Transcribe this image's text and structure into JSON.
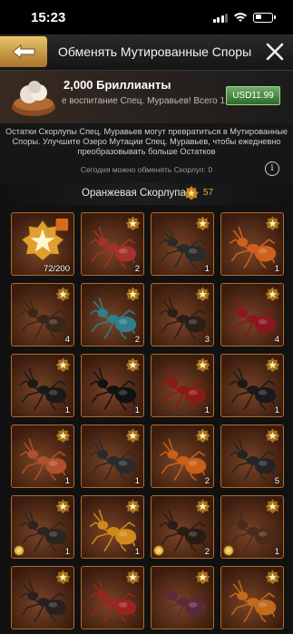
{
  "status": {
    "time": "15:23"
  },
  "header": {
    "title": "Обменять Мутированные Споры"
  },
  "offer": {
    "title": "2,000 Бриллианты",
    "subtitle": "е воспитание Спец. Муравьев! Всего 15",
    "price": "USD11.99"
  },
  "info": {
    "text": "Остатки Скорлупы Спец. Муравьев могут превратиться в Мутированные Споры. Улучшите Озеро Мутации Спец. Муравьев, чтобы ежедневно преобразовывать больше Остатков",
    "daily": "Сегодня можно обменять Скорлуп: 0"
  },
  "section": {
    "label": "Оранжевая Скорлупа",
    "count": "57"
  },
  "colors": {
    "accent": "#e0b040",
    "tile_border": "#b06a2a",
    "price_green": "#3f8a38"
  },
  "items": [
    {
      "kind": "medal",
      "qty": "72/200",
      "color": "#e0a030"
    },
    {
      "kind": "ant",
      "qty": "2",
      "color": "#a3322a"
    },
    {
      "kind": "ant",
      "qty": "1",
      "color": "#2a2a2a"
    },
    {
      "kind": "ant",
      "qty": "1",
      "color": "#d0601e"
    },
    {
      "kind": "ant",
      "qty": "4",
      "color": "#3a2618"
    },
    {
      "kind": "ant",
      "qty": "2",
      "color": "#2f7f8a"
    },
    {
      "kind": "ant",
      "qty": "3",
      "color": "#2a1e18"
    },
    {
      "kind": "ant",
      "qty": "4",
      "color": "#8a1620"
    },
    {
      "kind": "ant",
      "qty": "1",
      "color": "#1a1a1a"
    },
    {
      "kind": "ant",
      "qty": "1",
      "color": "#121212"
    },
    {
      "kind": "ant",
      "qty": "1",
      "color": "#8a1a14"
    },
    {
      "kind": "ant",
      "qty": "1",
      "color": "#1a1a1a"
    },
    {
      "kind": "ant",
      "qty": "1",
      "color": "#b0502a"
    },
    {
      "kind": "ant",
      "qty": "1",
      "color": "#2a2a2a"
    },
    {
      "kind": "ant",
      "qty": "2",
      "color": "#c8601a"
    },
    {
      "kind": "ant",
      "qty": "5",
      "color": "#242424"
    },
    {
      "kind": "ant",
      "qty": "1",
      "color": "#2c2420",
      "coin": true
    },
    {
      "kind": "ant",
      "qty": "1",
      "color": "#d08a1a"
    },
    {
      "kind": "ant",
      "qty": "2",
      "color": "#281c14",
      "coin": true
    },
    {
      "kind": "ant",
      "qty": "1",
      "color": "#4a2a18",
      "coin": true
    },
    {
      "kind": "ant",
      "qty": "",
      "color": "#2a2020"
    },
    {
      "kind": "ant",
      "qty": "",
      "color": "#9a2420"
    },
    {
      "kind": "ant",
      "qty": "",
      "color": "#5a2a3a"
    },
    {
      "kind": "ant",
      "qty": "",
      "color": "#c06a1a"
    }
  ]
}
